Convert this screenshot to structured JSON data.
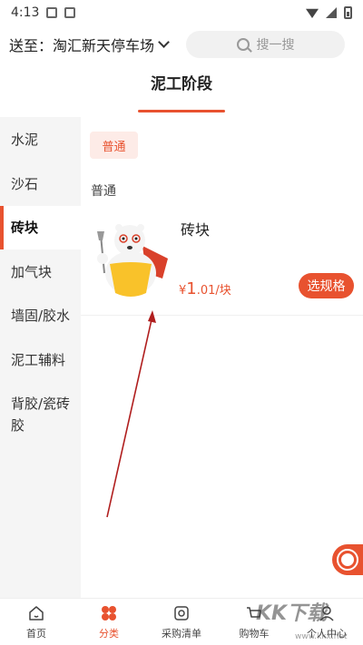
{
  "status": {
    "time": "4:13"
  },
  "header": {
    "deliver_prefix": "送至：",
    "location": "淘汇新天停车场",
    "search_placeholder": "搜一搜"
  },
  "stage": {
    "title": "泥工阶段"
  },
  "sidebar": {
    "items": [
      {
        "label": "水泥"
      },
      {
        "label": "沙石"
      },
      {
        "label": "砖块"
      },
      {
        "label": "加气块"
      },
      {
        "label": "墙固/胶水"
      },
      {
        "label": "泥工辅料"
      },
      {
        "label": "背胶/瓷砖胶"
      }
    ],
    "active_index": 2
  },
  "content": {
    "chip": "普通",
    "section_label": "普通",
    "product": {
      "name": "砖块",
      "currency": "¥",
      "price_int": "1",
      "price_rest": ".01/块",
      "spec_button": "选规格"
    }
  },
  "tabs": [
    {
      "label": "首页",
      "icon": "home-icon"
    },
    {
      "label": "分类",
      "icon": "category-icon"
    },
    {
      "label": "采购清单",
      "icon": "list-icon"
    },
    {
      "label": "购物车",
      "icon": "cart-icon"
    },
    {
      "label": "个人中心",
      "icon": "user-icon"
    }
  ],
  "watermark": {
    "text": "KK下载",
    "sub": "www.kkx.net"
  },
  "colors": {
    "accent": "#e8522f",
    "sidebar_bg": "#f5f5f5",
    "annotation_arrow": "#b01e1e"
  }
}
